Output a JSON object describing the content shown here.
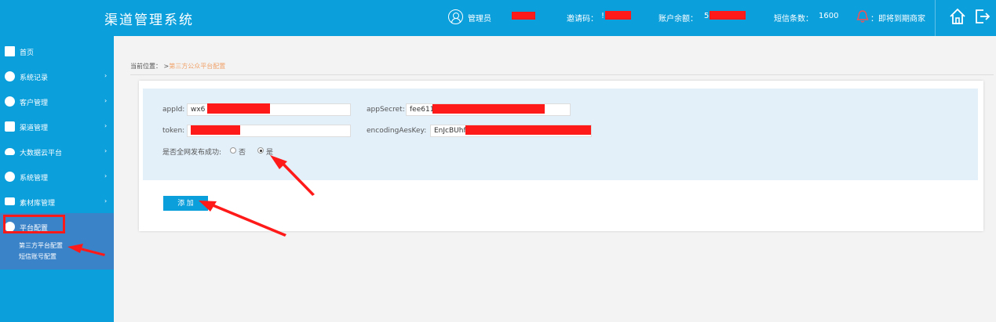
{
  "header": {
    "title": "渠道管理系统",
    "user_label": "管理员",
    "invite_label": "邀请码：",
    "invite_visible": "!",
    "balance_label": "账户余额：",
    "balance_visible": "5",
    "sms_label": "短信条数：",
    "sms_count": "1600",
    "notice_text": "：即将到期商家"
  },
  "sidebar": {
    "items": [
      {
        "label": "首页",
        "icon": "home-icon"
      },
      {
        "label": "系统记录",
        "icon": "record-icon"
      },
      {
        "label": "客户管理",
        "icon": "customer-icon"
      },
      {
        "label": "渠道管理",
        "icon": "channel-icon"
      },
      {
        "label": "大数据云平台",
        "icon": "cloud-icon"
      },
      {
        "label": "系统管理",
        "icon": "settings-icon"
      },
      {
        "label": "素材库管理",
        "icon": "library-icon"
      },
      {
        "label": "平台配置",
        "icon": "platform-icon"
      }
    ],
    "arrow": "›",
    "sub_items": [
      "第三方平台配置",
      "短信账号配置"
    ]
  },
  "breadcrumb": {
    "prefix": "当前位置：",
    "sep": ">",
    "current": "第三方公众平台配置"
  },
  "form": {
    "appid_label": "appId:",
    "appid_value": "wx6",
    "appsecret_label": "appSecret:",
    "appsecret_value": "fee611",
    "token_label": "token:",
    "token_value": "",
    "aeskey_label": "encodingAesKey:",
    "aeskey_value": "EnJcBUhf",
    "publish_label": "是否全网发布成功:",
    "option_no": "否",
    "option_yes": "是",
    "selected": "是"
  },
  "add_button": "添 加",
  "colors": {
    "brand": "#0b9fdc",
    "active_nav": "#3b83c8",
    "redaction": "#ff1a1a",
    "breadcrumb_current": "#f0a26a"
  }
}
